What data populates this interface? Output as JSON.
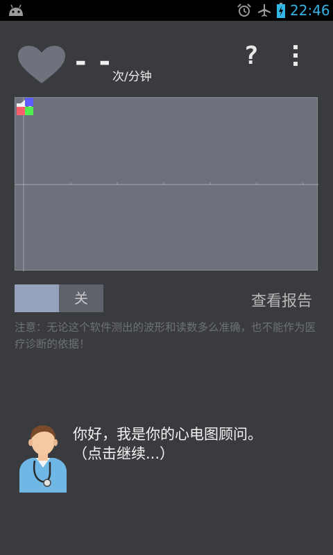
{
  "status_bar": {
    "time": "22:46",
    "icons": [
      "android-icon",
      "alarm-icon",
      "airplane-icon",
      "battery-icon"
    ],
    "time_color": "#33b5e5"
  },
  "header": {
    "bpm_value": "- -",
    "bpm_unit": "次/分钟",
    "help_label": "?",
    "menu_icon": "overflow-menu-icon"
  },
  "ecg_panel": {
    "background": "#6e717c",
    "speaker_icon": "speaker-icon",
    "legend_colors": [
      "#5c5cff",
      "#ff5c6c",
      "#50ee50"
    ]
  },
  "controls": {
    "toggle_state": "关",
    "report_label": "查看报告"
  },
  "notice": "注意：无论这个软件测出的波形和读数多么准确，也不能作为医疗诊断的依据！",
  "assistant": {
    "message": "你好，我是你的心电图顾问。（点击继续...）"
  }
}
